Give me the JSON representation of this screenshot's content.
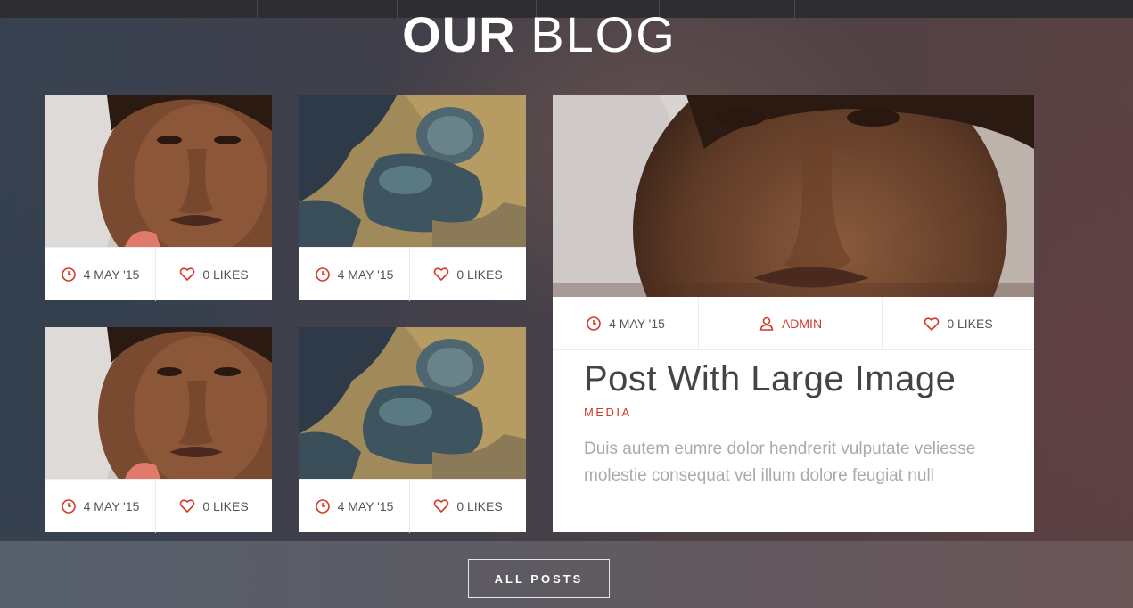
{
  "heading": {
    "bold": "OUR",
    "light": "BLOG"
  },
  "cards": [
    {
      "date": "4 MAY '15",
      "likes": "0 LIKES",
      "image": "portrait"
    },
    {
      "date": "4 MAY '15",
      "likes": "0 LIKES",
      "image": "statue"
    },
    {
      "date": "4 MAY '15",
      "likes": "0 LIKES",
      "image": "portrait"
    },
    {
      "date": "4 MAY '15",
      "likes": "0 LIKES",
      "image": "statue"
    }
  ],
  "featured": {
    "date": "4 MAY '15",
    "author": "ADMIN",
    "likes": "0 LIKES",
    "title": "Post With Large Image",
    "category": "MEDIA",
    "excerpt": "Duis autem eumre dolor hendrerit vulputate veliesse molestie consequat vel illum dolore feugiat null"
  },
  "all_posts_label": "ALL POSTS",
  "colors": {
    "accent": "#d23a2a",
    "card": "#ffffff",
    "text": "#555555"
  }
}
